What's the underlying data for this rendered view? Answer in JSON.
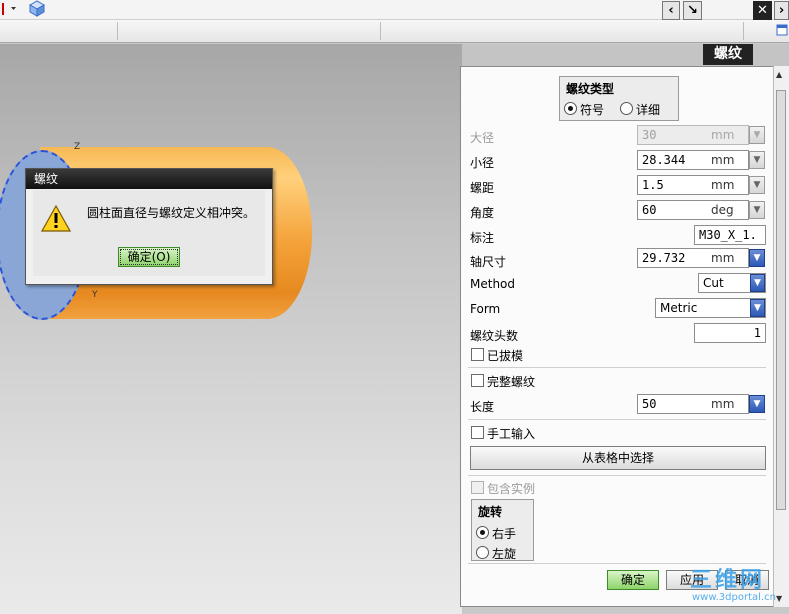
{
  "panel": {
    "title": "螺纹",
    "thread_type": {
      "label": "螺纹类型",
      "options": [
        "符号",
        "详细"
      ],
      "selected": "符号"
    },
    "fields": [
      {
        "label": "大径",
        "value": "30",
        "unit": "mm",
        "disabled": true
      },
      {
        "label": "小径",
        "value": "28.344",
        "unit": "mm",
        "disabled": false
      },
      {
        "label": "螺距",
        "value": "1.5",
        "unit": "mm",
        "disabled": false
      },
      {
        "label": "角度",
        "value": "60",
        "unit": "deg",
        "disabled": false
      }
    ],
    "callout": {
      "label": "标注",
      "value": "M30_X_1."
    },
    "shaft_size": {
      "label": "轴尺寸",
      "value": "29.732",
      "unit": "mm"
    },
    "method": {
      "label": "Method",
      "value": "Cut"
    },
    "form": {
      "label": "Form",
      "value": "Metric"
    },
    "starts": {
      "label": "螺纹头数",
      "value": "1"
    },
    "tapered": {
      "label": "已拔模",
      "checked": false
    },
    "full_thread": {
      "label": "完整螺纹",
      "checked": false
    },
    "length": {
      "label": "长度",
      "value": "50",
      "unit": "mm"
    },
    "manual_input": {
      "label": "手工输入",
      "checked": false
    },
    "choose_from_table": "从表格中选择",
    "include_instances": {
      "label": "包含实例",
      "checked": false
    },
    "rotation": {
      "label": "旋转",
      "options": [
        "右手",
        "左旋"
      ],
      "selected": "右手"
    },
    "buttons": {
      "ok": "确定",
      "apply": "应用",
      "cancel": "取消"
    }
  },
  "dialog": {
    "title": "螺纹",
    "message": "圆柱面直径与螺纹定义相冲突。",
    "ok": "确定(O)"
  },
  "viewport": {
    "axis_z": "Z",
    "axis_y": "Y"
  },
  "watermark": {
    "line1": "三维网",
    "line2": "www.3dportal.cn"
  }
}
